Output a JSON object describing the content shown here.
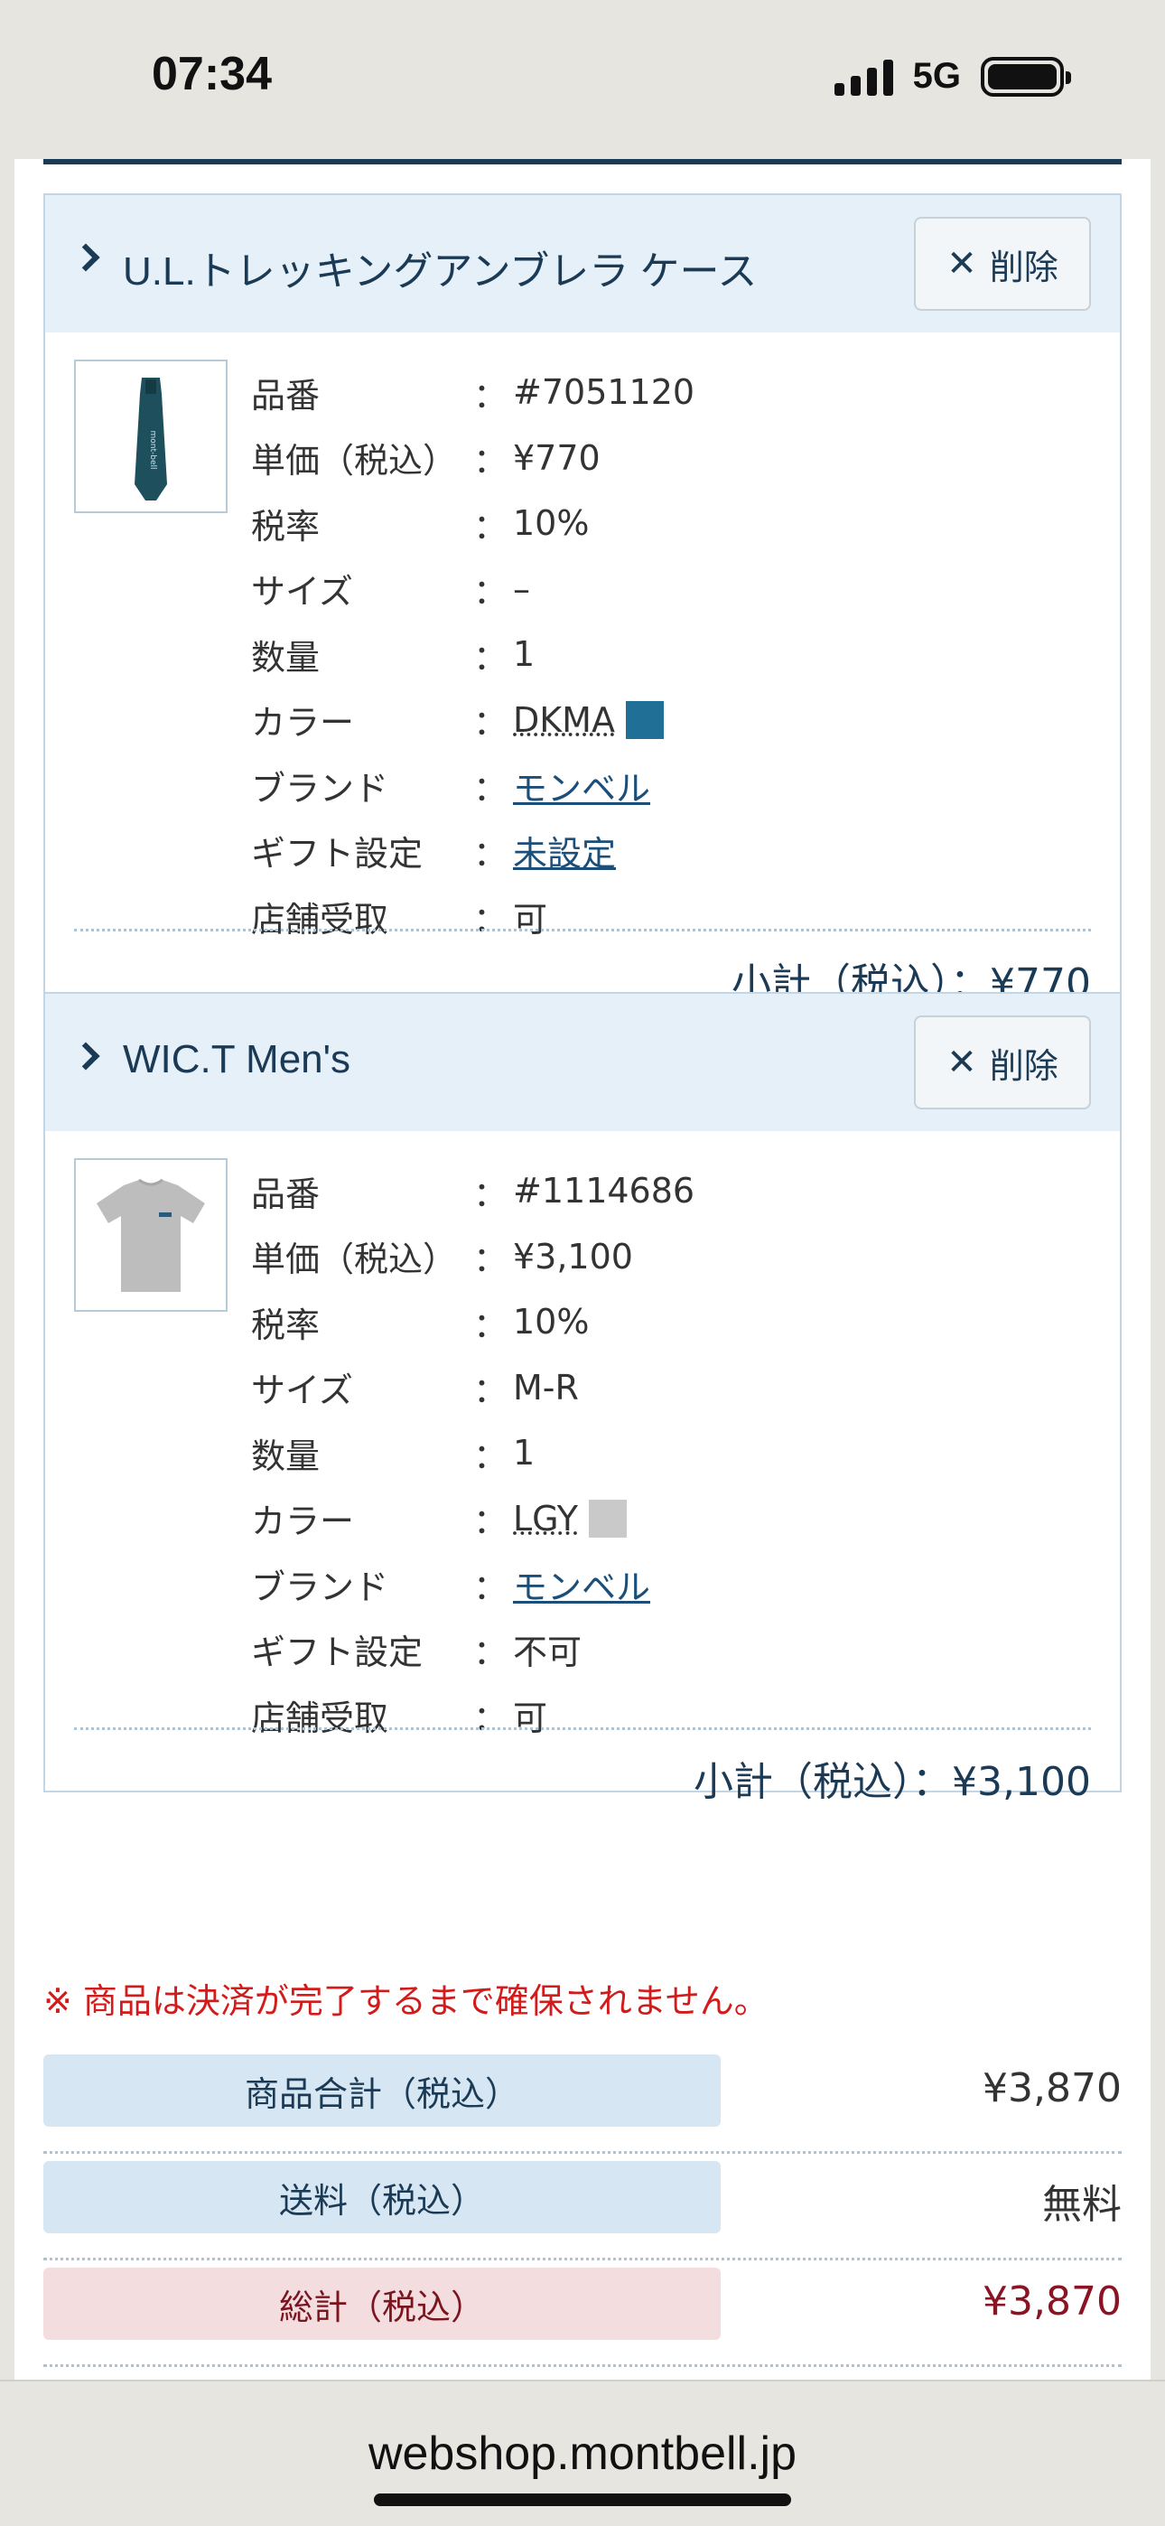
{
  "status_bar": {
    "time": "07:34",
    "network": "5G"
  },
  "items": [
    {
      "title": "U.L.トレッキングアンブレラ ケース",
      "delete_label": "削除",
      "rows": [
        {
          "key": "品番",
          "value": "#7051120"
        },
        {
          "key": "単価（税込）",
          "value": "¥770"
        },
        {
          "key": "税率",
          "value": "10%"
        },
        {
          "key": "サイズ",
          "value": "–"
        },
        {
          "key": "数量",
          "value": "1"
        },
        {
          "key": "カラー",
          "value": "DKMA"
        },
        {
          "key": "ブランド",
          "value": "モンベル"
        },
        {
          "key": "ギフト設定",
          "value": "未設定"
        },
        {
          "key": "店舗受取",
          "value": "可"
        }
      ],
      "color_swatch": "#1f6f96",
      "subtotal": "小計（税込）：¥770"
    },
    {
      "title": "WIC.T Men's",
      "delete_label": "削除",
      "rows": [
        {
          "key": "品番",
          "value": "#1114686"
        },
        {
          "key": "単価（税込）",
          "value": "¥3,100"
        },
        {
          "key": "税率",
          "value": "10%"
        },
        {
          "key": "サイズ",
          "value": "M-R"
        },
        {
          "key": "数量",
          "value": "1"
        },
        {
          "key": "カラー",
          "value": "LGY"
        },
        {
          "key": "ブランド",
          "value": "モンベル"
        },
        {
          "key": "ギフト設定",
          "value": "不可"
        },
        {
          "key": "店舗受取",
          "value": "可"
        }
      ],
      "color_swatch": "#c9c9c9",
      "subtotal": "小計（税込）：¥3,100"
    }
  ],
  "notice": "※ 商品は決済が完了するまで確保されません。",
  "summary": [
    {
      "label": "商品合計（税込）",
      "value": "¥3,870"
    },
    {
      "label": "送料（税込）",
      "value": "無料"
    },
    {
      "label": "総計（税込）",
      "value": "¥3,870"
    }
  ],
  "url_bar": {
    "url": "webshop.montbell.jp"
  },
  "colors": {
    "navy": "#1b3a55",
    "header_bg": "#e6f0f8",
    "notice_red": "#d21c1c",
    "total_red": "#8a1424"
  },
  "row_separator": "："
}
